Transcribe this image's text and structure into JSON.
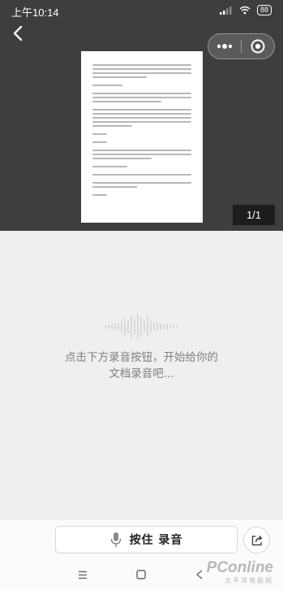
{
  "status_bar": {
    "time": "上午10:14",
    "battery": "88"
  },
  "viewer": {
    "page_counter": "1/1"
  },
  "recorder": {
    "hint_line1": "点击下方录音按钮，开始给你的",
    "hint_line2": "文档录音吧..."
  },
  "bottom_bar": {
    "record_label": "按住 录音"
  },
  "watermark": {
    "brand": "PConline",
    "sub": "太平洋电脑网"
  },
  "icons": {
    "back": "chevron-left-icon",
    "more": "more-dots-icon",
    "close": "target-circle-icon",
    "mic": "microphone-icon",
    "share": "share-icon",
    "waveform": "waveform-icon",
    "nav_menu": "menu-lines-icon",
    "nav_home": "square-home-icon",
    "nav_back": "back-triangle-icon"
  },
  "colors": {
    "viewer_bg": "#3e3e3e",
    "app_bg": "#efefef",
    "hint_text": "#7f7f7f"
  }
}
